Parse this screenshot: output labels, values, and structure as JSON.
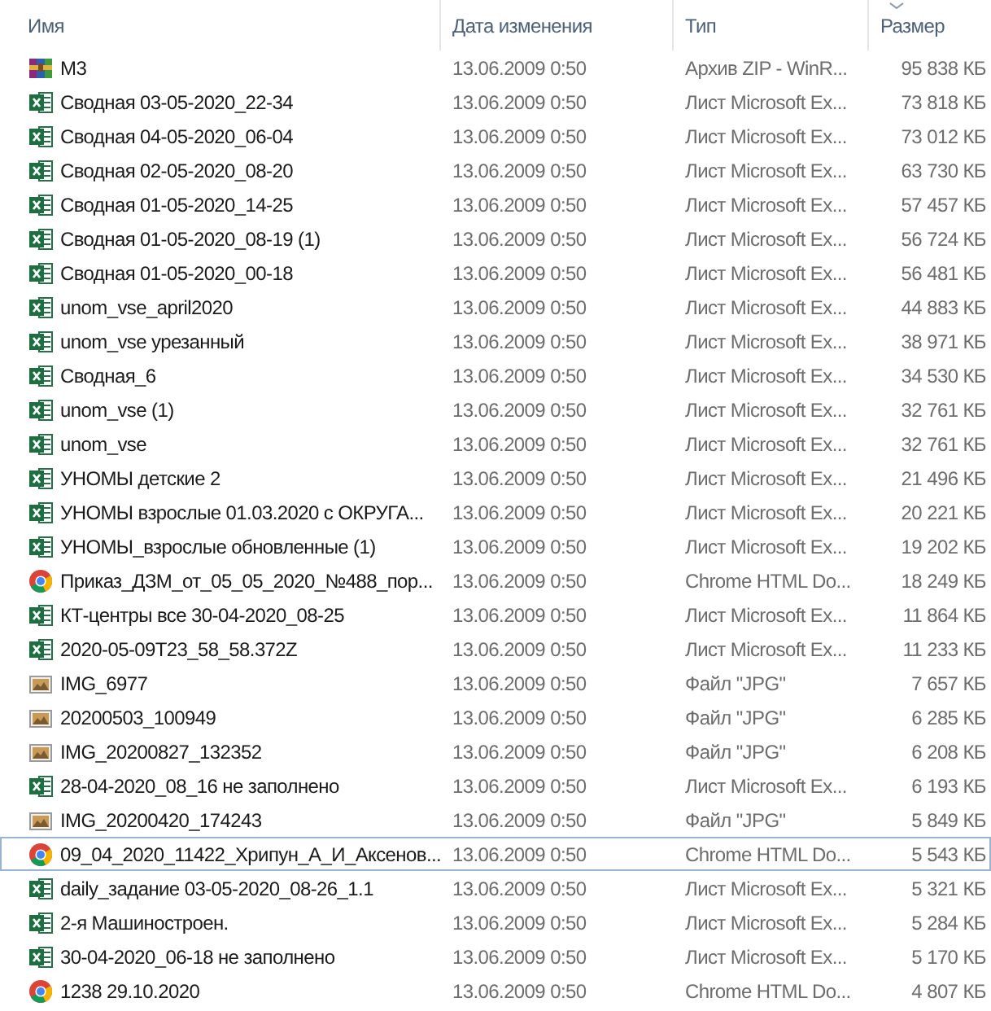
{
  "columns": [
    {
      "label": "Имя",
      "sorted": false
    },
    {
      "label": "Дата изменения",
      "sorted": false
    },
    {
      "label": "Тип",
      "sorted": false
    },
    {
      "label": "Размер",
      "sorted": true
    }
  ],
  "rows": [
    {
      "kind": "archive",
      "name": "M3",
      "date": "13.06.2009 0:50",
      "type": "Архив ZIP - WinR...",
      "size": "95 838 КБ",
      "focused": false
    },
    {
      "kind": "spreadsheet",
      "name": "Сводная 03-05-2020_22-34",
      "date": "13.06.2009 0:50",
      "type": "Лист Microsoft Ex...",
      "size": "73 818 КБ",
      "focused": false
    },
    {
      "kind": "spreadsheet",
      "name": "Сводная 04-05-2020_06-04",
      "date": "13.06.2009 0:50",
      "type": "Лист Microsoft Ex...",
      "size": "73 012 КБ",
      "focused": false
    },
    {
      "kind": "spreadsheet",
      "name": "Сводная 02-05-2020_08-20",
      "date": "13.06.2009 0:50",
      "type": "Лист Microsoft Ex...",
      "size": "63 730 КБ",
      "focused": false
    },
    {
      "kind": "spreadsheet",
      "name": "Сводная 01-05-2020_14-25",
      "date": "13.06.2009 0:50",
      "type": "Лист Microsoft Ex...",
      "size": "57 457 КБ",
      "focused": false
    },
    {
      "kind": "spreadsheet",
      "name": "Сводная 01-05-2020_08-19 (1)",
      "date": "13.06.2009 0:50",
      "type": "Лист Microsoft Ex...",
      "size": "56 724 КБ",
      "focused": false
    },
    {
      "kind": "spreadsheet",
      "name": "Сводная 01-05-2020_00-18",
      "date": "13.06.2009 0:50",
      "type": "Лист Microsoft Ex...",
      "size": "56 481 КБ",
      "focused": false
    },
    {
      "kind": "spreadsheet",
      "name": "unom_vse_april2020",
      "date": "13.06.2009 0:50",
      "type": "Лист Microsoft Ex...",
      "size": "44 883 КБ",
      "focused": false
    },
    {
      "kind": "spreadsheet",
      "name": "unom_vse урезанный",
      "date": "13.06.2009 0:50",
      "type": "Лист Microsoft Ex...",
      "size": "38 971 КБ",
      "focused": false
    },
    {
      "kind": "spreadsheet",
      "name": "Сводная_6",
      "date": "13.06.2009 0:50",
      "type": "Лист Microsoft Ex...",
      "size": "34 530 КБ",
      "focused": false
    },
    {
      "kind": "spreadsheet",
      "name": "unom_vse (1)",
      "date": "13.06.2009 0:50",
      "type": "Лист Microsoft Ex...",
      "size": "32 761 КБ",
      "focused": false
    },
    {
      "kind": "spreadsheet",
      "name": "unom_vse",
      "date": "13.06.2009 0:50",
      "type": "Лист Microsoft Ex...",
      "size": "32 761 КБ",
      "focused": false
    },
    {
      "kind": "spreadsheet",
      "name": "УНОМЫ детские 2",
      "date": "13.06.2009 0:50",
      "type": "Лист Microsoft Ex...",
      "size": "21 496 КБ",
      "focused": false
    },
    {
      "kind": "spreadsheet",
      "name": "УНОМЫ взрослые 01.03.2020 с ОКРУГА...",
      "date": "13.06.2009 0:50",
      "type": "Лист Microsoft Ex...",
      "size": "20 221 КБ",
      "focused": false
    },
    {
      "kind": "spreadsheet",
      "name": "УНОМЫ_взрослые обновленные (1)",
      "date": "13.06.2009 0:50",
      "type": "Лист Microsoft Ex...",
      "size": "19 202 КБ",
      "focused": false
    },
    {
      "kind": "browser",
      "name": "Приказ_ДЗМ_от_05_05_2020_№488_пор...",
      "date": "13.06.2009 0:50",
      "type": "Chrome HTML Do...",
      "size": "18 249 КБ",
      "focused": false
    },
    {
      "kind": "spreadsheet",
      "name": "КТ-центры все 30-04-2020_08-25",
      "date": "13.06.2009 0:50",
      "type": "Лист Microsoft Ex...",
      "size": "11 864 КБ",
      "focused": false
    },
    {
      "kind": "spreadsheet",
      "name": "2020-05-09T23_58_58.372Z",
      "date": "13.06.2009 0:50",
      "type": "Лист Microsoft Ex...",
      "size": "11 233 КБ",
      "focused": false
    },
    {
      "kind": "image",
      "name": "IMG_6977",
      "date": "13.06.2009 0:50",
      "type": "Файл \"JPG\"",
      "size": "7 657 КБ",
      "focused": false
    },
    {
      "kind": "image",
      "name": "20200503_100949",
      "date": "13.06.2009 0:50",
      "type": "Файл \"JPG\"",
      "size": "6 285 КБ",
      "focused": false
    },
    {
      "kind": "image",
      "name": "IMG_20200827_132352",
      "date": "13.06.2009 0:50",
      "type": "Файл \"JPG\"",
      "size": "6 208 КБ",
      "focused": false
    },
    {
      "kind": "spreadsheet",
      "name": "28-04-2020_08_16 не заполнено",
      "date": "13.06.2009 0:50",
      "type": "Лист Microsoft Ex...",
      "size": "6 193 КБ",
      "focused": false
    },
    {
      "kind": "image",
      "name": "IMG_20200420_174243",
      "date": "13.06.2009 0:50",
      "type": "Файл \"JPG\"",
      "size": "5 849 КБ",
      "focused": false
    },
    {
      "kind": "browser",
      "name": "09_04_2020_11422_Хрипун_А_И_Аксенов...",
      "date": "13.06.2009 0:50",
      "type": "Chrome HTML Do...",
      "size": "5 543 КБ",
      "focused": true
    },
    {
      "kind": "spreadsheet",
      "name": "daily_задание 03-05-2020_08-26_1.1",
      "date": "13.06.2009 0:50",
      "type": "Лист Microsoft Ex...",
      "size": "5 321 КБ",
      "focused": false
    },
    {
      "kind": "spreadsheet",
      "name": "2-я Машиностроен.",
      "date": "13.06.2009 0:50",
      "type": "Лист Microsoft Ex...",
      "size": "5 284 КБ",
      "focused": false
    },
    {
      "kind": "spreadsheet",
      "name": "30-04-2020_06-18 не заполнено",
      "date": "13.06.2009 0:50",
      "type": "Лист Microsoft Ex...",
      "size": "5 170 КБ",
      "focused": false
    },
    {
      "kind": "browser",
      "name": "1238 29.10.2020",
      "date": "13.06.2009 0:50",
      "type": "Chrome HTML Do...",
      "size": "4 807 КБ",
      "focused": false
    }
  ]
}
